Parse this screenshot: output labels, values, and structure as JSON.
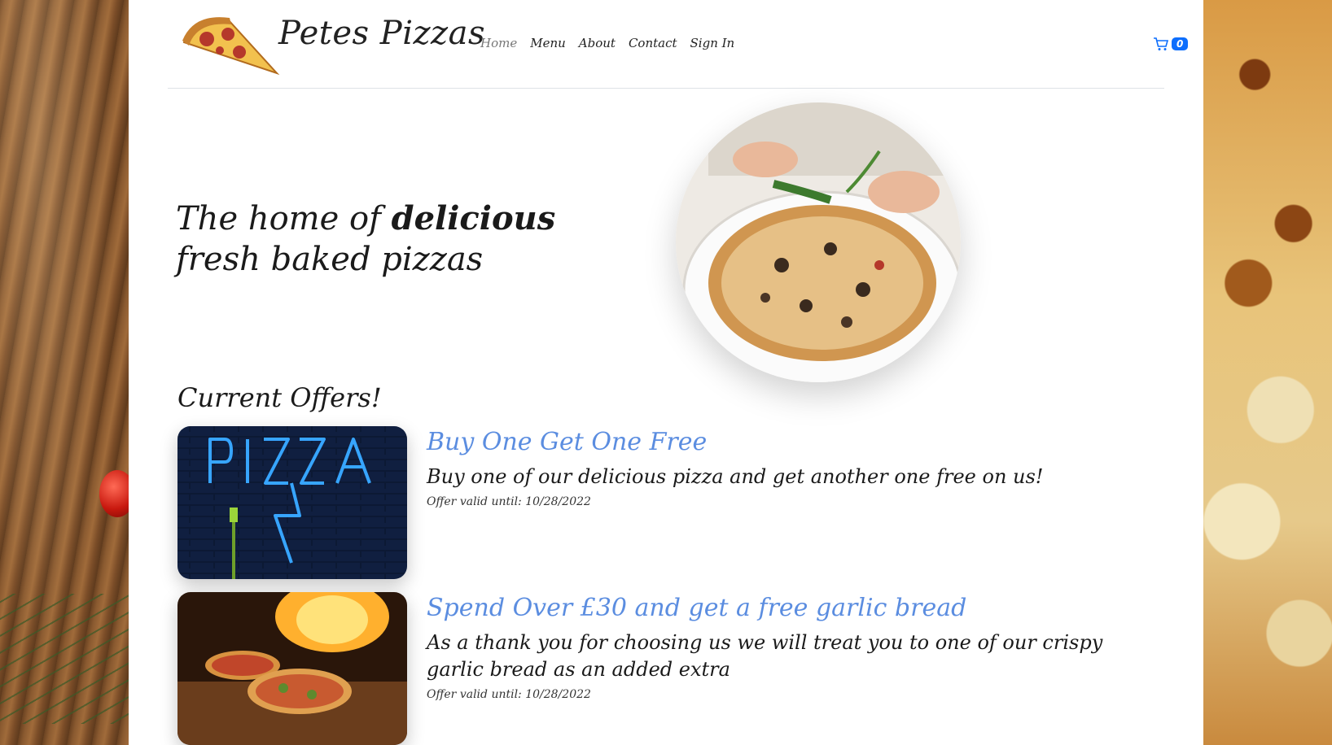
{
  "brand": {
    "name": "Petes Pizzas"
  },
  "nav": {
    "items": [
      "Home",
      "Menu",
      "About",
      "Contact",
      "Sign In"
    ],
    "active": "Home"
  },
  "cart": {
    "count": "0",
    "icon": "cart-icon"
  },
  "hero": {
    "title_pre": "The home of ",
    "title_bold": "delicious",
    "title_post": " fresh baked pizzas"
  },
  "offers": {
    "heading": "Current Offers!",
    "items": [
      {
        "title": "Buy One Get One Free",
        "description": "Buy one of our delicious pizza and get another one free on us!",
        "valid": "Offer valid until: 10/28/2022"
      },
      {
        "title": "Spend Over £30 and get a free garlic bread",
        "description": "As a thank you for choosing us we will treat you to one of our crispy garlic bread as an added extra",
        "valid": "Offer valid until: 10/28/2022"
      }
    ]
  },
  "colors": {
    "offer_title": "#5b8de0",
    "badge": "#0d6efd",
    "divider": "#dee2e6"
  }
}
